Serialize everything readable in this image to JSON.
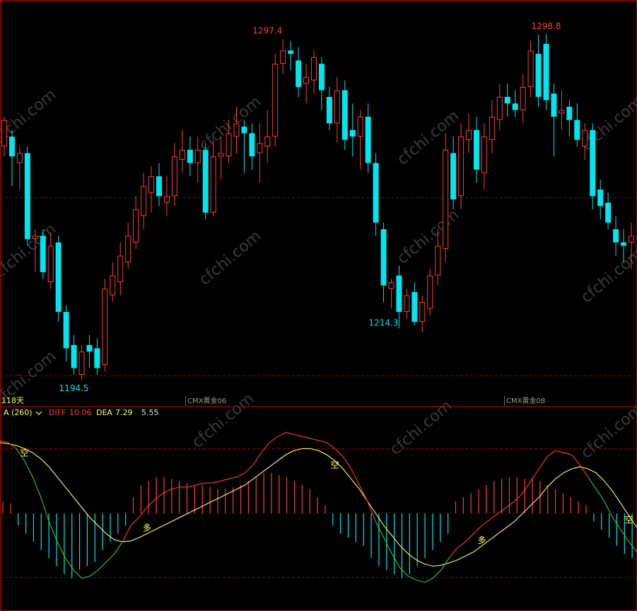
{
  "colors": {
    "up": "#ff3b3b",
    "down": "#00e5ee",
    "frame": "#b40000",
    "grid": "#8a0000",
    "yellow": "#ffff66",
    "green": "#33cc33",
    "white": "#e6e6e6",
    "watermark": "#3a3a3a"
  },
  "labels": {
    "period": "118天",
    "contract_a": "CMX黄金06",
    "contract_b": "CMX黄金08",
    "indicator": "A (260)",
    "dropdown_icon": "chevron-down-icon",
    "diff_label": "DIFF",
    "diff_value": "10.06",
    "dea_label": "DEA",
    "dea_value": "7.29",
    "macd_value": "5.55",
    "watermark": "cfchi.com"
  },
  "chart_data": [
    {
      "type": "candlestick",
      "price_range": [
        1190,
        1305
      ],
      "annotations": [
        {
          "text": "1297.4",
          "bar": 34,
          "price": 1297.4,
          "kind": "high"
        },
        {
          "text": "1194.5",
          "bar": 9,
          "price": 1194.5,
          "kind": "low"
        },
        {
          "text": "1214.3",
          "bar": 49,
          "price": 1214.3,
          "kind": "low"
        },
        {
          "text": "1298.8",
          "bar": 70,
          "price": 1298.8,
          "kind": "high"
        }
      ],
      "candles": [
        [
          1265,
          1273,
          1274,
          1262
        ],
        [
          1268,
          1262,
          1270,
          1253
        ],
        [
          1260,
          1263,
          1265,
          1252
        ],
        [
          1263,
          1237,
          1265,
          1235
        ],
        [
          1237,
          1238,
          1240,
          1227
        ],
        [
          1238,
          1227,
          1240,
          1225
        ],
        [
          1224,
          1235,
          1239,
          1222
        ],
        [
          1236,
          1215,
          1238,
          1212
        ],
        [
          1215,
          1204,
          1217,
          1200
        ],
        [
          1205,
          1198,
          1208,
          1196
        ],
        [
          1196,
          1203,
          1205,
          1194.5
        ],
        [
          1205,
          1203,
          1208,
          1198
        ],
        [
          1204,
          1198,
          1207,
          1196
        ],
        [
          1199,
          1222,
          1225,
          1197
        ],
        [
          1220,
          1226,
          1230,
          1218
        ],
        [
          1224,
          1232,
          1236,
          1220
        ],
        [
          1230,
          1238,
          1242,
          1228
        ],
        [
          1236,
          1246,
          1250,
          1234
        ],
        [
          1244,
          1253,
          1257,
          1240
        ],
        [
          1251,
          1256,
          1259,
          1245
        ],
        [
          1256,
          1250,
          1260,
          1247
        ],
        [
          1248,
          1250,
          1256,
          1244
        ],
        [
          1250,
          1262,
          1266,
          1247
        ],
        [
          1261,
          1264,
          1270,
          1257
        ],
        [
          1264,
          1260,
          1268,
          1256
        ],
        [
          1260,
          1264,
          1268,
          1254
        ],
        [
          1264,
          1245,
          1266,
          1243
        ],
        [
          1245,
          1262,
          1267,
          1244
        ],
        [
          1262,
          1263,
          1268,
          1255
        ],
        [
          1262,
          1269,
          1273,
          1260
        ],
        [
          1268,
          1272,
          1277,
          1263
        ],
        [
          1271,
          1269,
          1273,
          1257
        ],
        [
          1269,
          1262,
          1272,
          1258
        ],
        [
          1263,
          1266,
          1272,
          1254
        ],
        [
          1265,
          1268,
          1276,
          1260
        ],
        [
          1268,
          1290,
          1293,
          1265
        ],
        [
          1290,
          1294,
          1297.4,
          1287
        ],
        [
          1294,
          1293,
          1297,
          1288
        ],
        [
          1291,
          1283,
          1295,
          1280
        ],
        [
          1284,
          1286,
          1290,
          1278
        ],
        [
          1285,
          1292,
          1294,
          1281
        ],
        [
          1290,
          1282,
          1292,
          1276
        ],
        [
          1280,
          1272,
          1283,
          1270
        ],
        [
          1272,
          1282,
          1286,
          1266
        ],
        [
          1282,
          1267,
          1285,
          1264
        ],
        [
          1270,
          1268,
          1278,
          1262
        ],
        [
          1268,
          1274,
          1276,
          1258
        ],
        [
          1274,
          1260,
          1278,
          1257
        ],
        [
          1260,
          1242,
          1263,
          1238
        ],
        [
          1240,
          1223,
          1242,
          1218
        ],
        [
          1222,
          1224,
          1225,
          1216
        ],
        [
          1226,
          1215,
          1229,
          1210
        ],
        [
          1215,
          1220,
          1222,
          1213
        ],
        [
          1221,
          1212,
          1224,
          1211
        ],
        [
          1212,
          1218,
          1220,
          1209
        ],
        [
          1216,
          1226,
          1228,
          1214
        ],
        [
          1226,
          1235,
          1240,
          1223
        ],
        [
          1234,
          1264,
          1269,
          1230
        ],
        [
          1263,
          1249,
          1268,
          1246
        ],
        [
          1250,
          1268,
          1272,
          1246
        ],
        [
          1267,
          1270,
          1275,
          1263
        ],
        [
          1270,
          1258,
          1274,
          1254
        ],
        [
          1257,
          1268,
          1272,
          1252
        ],
        [
          1267,
          1274,
          1279,
          1263
        ],
        [
          1273,
          1280,
          1284,
          1270
        ],
        [
          1280,
          1278,
          1284,
          1274
        ],
        [
          1278,
          1276,
          1282,
          1274
        ],
        [
          1276,
          1283,
          1287,
          1272
        ],
        [
          1283,
          1294,
          1297,
          1280
        ],
        [
          1293,
          1280,
          1298.8,
          1277
        ],
        [
          1296,
          1279,
          1299,
          1276
        ],
        [
          1281,
          1274,
          1284,
          1262
        ],
        [
          1275,
          1276,
          1282,
          1270
        ],
        [
          1277,
          1273,
          1279,
          1268
        ],
        [
          1273,
          1267,
          1278,
          1265
        ],
        [
          1265,
          1270,
          1272,
          1261
        ],
        [
          1270,
          1250,
          1272,
          1246
        ],
        [
          1252,
          1247,
          1255,
          1243
        ],
        [
          1248,
          1242,
          1251,
          1240
        ],
        [
          1240,
          1236,
          1244,
          1232
        ],
        [
          1236,
          1235,
          1240,
          1230
        ],
        [
          1236,
          1238,
          1242,
          1228
        ]
      ]
    },
    {
      "type": "macd",
      "value_range": [
        -22,
        22
      ],
      "diff": [
        18,
        17.5,
        16,
        13,
        9,
        4,
        -2,
        -7,
        -11,
        -14,
        -16,
        -15.5,
        -14,
        -12,
        -10,
        -7,
        -3,
        -1,
        1.5,
        3.5,
        5,
        6,
        6.5,
        6.5,
        7,
        7.5,
        7.5,
        8,
        8.5,
        9,
        10,
        12,
        15,
        17.5,
        19,
        20,
        19.5,
        19,
        18.5,
        18,
        17.5,
        16,
        14,
        11,
        7,
        3,
        -2,
        -6,
        -10,
        -13.5,
        -15.5,
        -16.5,
        -17,
        -16,
        -14,
        -11,
        -8.5,
        -7,
        -5,
        -3,
        -1.5,
        0,
        1.5,
        3,
        5,
        8,
        11,
        14,
        15.5,
        15,
        14.5,
        12,
        9,
        6,
        3,
        -1,
        -4,
        -7,
        -9.5
      ],
      "dea": [
        17.5,
        17.2,
        16.8,
        16,
        15,
        13.5,
        11.5,
        9,
        6.5,
        4,
        1.5,
        -1,
        -3,
        -5,
        -6.5,
        -7,
        -6.8,
        -6,
        -5,
        -4,
        -3,
        -2,
        -1,
        0,
        1,
        2,
        3,
        4,
        5,
        6,
        7,
        8.5,
        10,
        11.5,
        13,
        14.5,
        15.5,
        16,
        16,
        15.5,
        14.5,
        13,
        11,
        8.5,
        6,
        3,
        0,
        -3,
        -5.5,
        -8,
        -10,
        -11.5,
        -12.5,
        -13,
        -12.8,
        -12.2,
        -11.5,
        -10.5,
        -9.5,
        -8,
        -6.5,
        -5,
        -3.5,
        -2,
        0,
        2,
        4,
        6.5,
        8.5,
        10,
        11,
        11.5,
        11,
        10,
        8,
        5.5,
        2.5,
        -0.5,
        -3.5
      ],
      "histogram": [
        3,
        2.5,
        -3,
        -5,
        -7,
        -9,
        -11,
        -13,
        -15,
        -16,
        -14,
        -13,
        -12,
        -9,
        -7,
        -5,
        -3,
        4,
        7,
        8,
        9,
        9,
        8.5,
        8,
        7.5,
        7,
        7,
        6.5,
        6,
        6,
        6.5,
        7,
        8,
        9,
        10,
        10,
        9.5,
        9,
        8,
        7,
        6,
        4,
        2,
        -3,
        -5,
        -6,
        -7,
        -8,
        -11,
        -13,
        -14,
        -15,
        -16,
        -15,
        -13,
        -11,
        -9,
        -7,
        -5,
        3,
        4,
        5,
        6,
        7,
        8,
        8.5,
        9,
        9,
        8.5,
        8.5,
        8,
        7,
        6,
        5,
        4,
        3,
        2,
        -2,
        -4,
        -6,
        -8,
        -10,
        -11
      ],
      "signals": [
        {
          "text": "空",
          "bar": 3
        },
        {
          "text": "多",
          "bar": 18
        },
        {
          "text": "空",
          "bar": 41
        },
        {
          "text": "多",
          "bar": 59
        },
        {
          "text": "空",
          "bar": 77
        }
      ]
    }
  ]
}
